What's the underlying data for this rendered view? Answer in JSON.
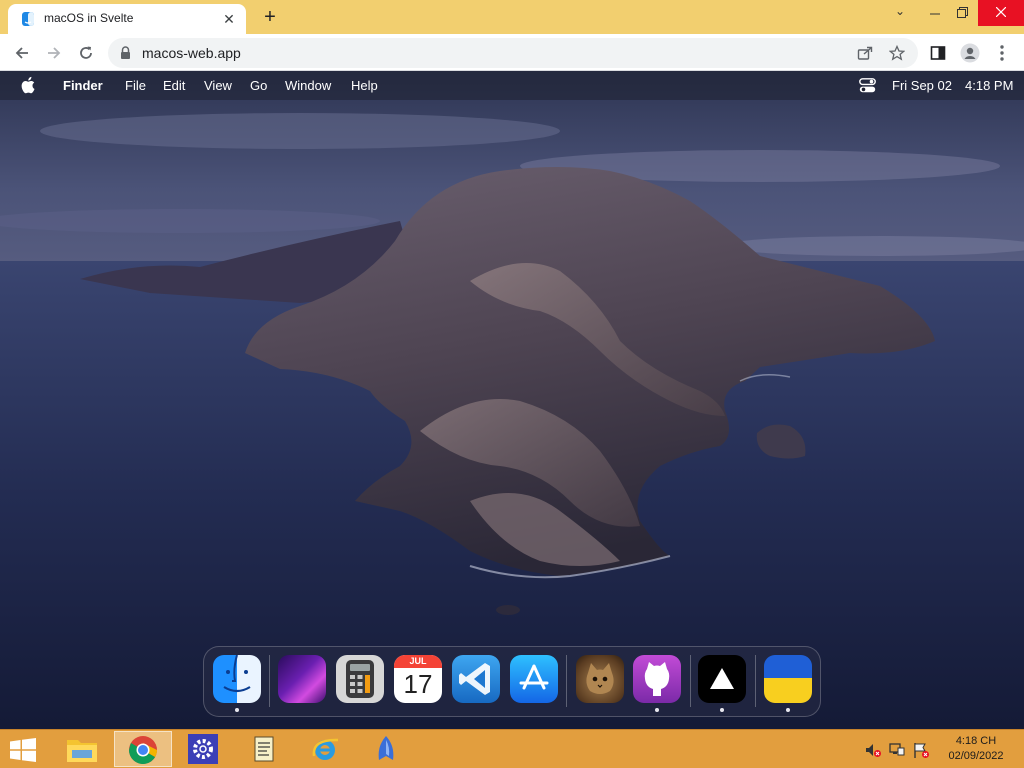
{
  "browser": {
    "tab_title": "macOS in Svelte",
    "tab_close": "✕",
    "new_tab": "+",
    "url": "macos-web.app",
    "colors": {
      "tabstrip": "#f2cf6f",
      "toolbar": "#ffffff",
      "close_hover": "#e81123"
    },
    "icons": [
      "back-icon",
      "forward-icon",
      "reload-icon",
      "lock-icon",
      "share-icon",
      "bookmark-star-icon",
      "side-panel-icon",
      "profile-icon",
      "kebab-menu-icon"
    ]
  },
  "menubar": {
    "app_name": "Finder",
    "items": [
      "File",
      "Edit",
      "View",
      "Go",
      "Window",
      "Help"
    ],
    "date": "Fri Sep 02",
    "time": "4:18 PM"
  },
  "dock": {
    "apps": [
      {
        "name": "finder",
        "running": true
      },
      {
        "name": "wallpapers",
        "running": false
      },
      {
        "name": "calculator",
        "running": false
      },
      {
        "name": "calendar",
        "running": false,
        "month": "JUL",
        "day": "17"
      },
      {
        "name": "vscode",
        "running": false
      },
      {
        "name": "appstore",
        "running": false
      },
      {
        "name": "purus-twitter",
        "running": false
      },
      {
        "name": "view-source",
        "running": true
      },
      {
        "name": "vercel",
        "running": true
      },
      {
        "name": "how-to-help-ukraine",
        "running": true
      }
    ]
  },
  "taskbar": {
    "apps": [
      "file-explorer",
      "chrome",
      "settings-app",
      "notepad-app",
      "internet-explorer",
      "app-launcher"
    ],
    "active_app": "chrome",
    "time": "4:18 CH",
    "date": "02/09/2022",
    "color": "#e29e3e"
  }
}
